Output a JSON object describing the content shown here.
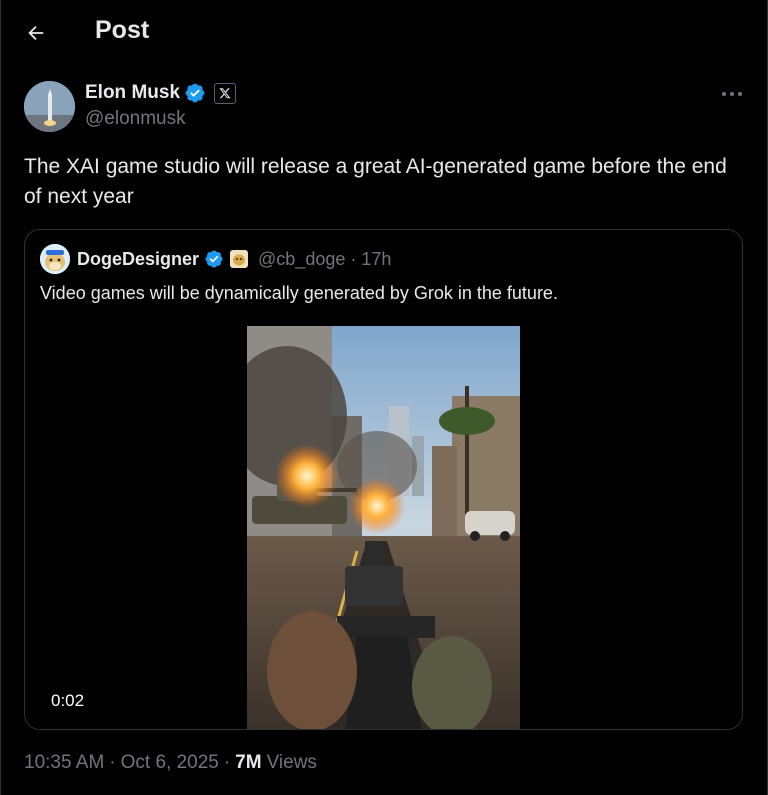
{
  "header": {
    "title": "Post"
  },
  "author": {
    "name": "Elon Musk",
    "handle": "@elonmusk"
  },
  "tweet": {
    "text": "The XAI game studio will release a great AI-generated game before the end of next year"
  },
  "quote": {
    "name": "DogeDesigner",
    "handle": "@cb_doge",
    "separator": "·",
    "time": "17h",
    "text": "Video games will be dynamically generated by Grok in the future.",
    "video_time": "0:02"
  },
  "meta": {
    "time": "10:35 AM",
    "sep1": "·",
    "date": "Oct 6, 2025",
    "sep2": "·",
    "views_count": "7M",
    "views_label": "Views"
  },
  "colors": {
    "background": "#000000",
    "text": "#e7e9ea",
    "muted": "#71767b",
    "verified": "#1d9bf0",
    "border": "#2f3336"
  },
  "icons": {
    "back": "arrow-left-icon",
    "verified": "verified-badge-icon",
    "affiliate": "x-logo-icon",
    "more": "more-horizontal-icon"
  }
}
